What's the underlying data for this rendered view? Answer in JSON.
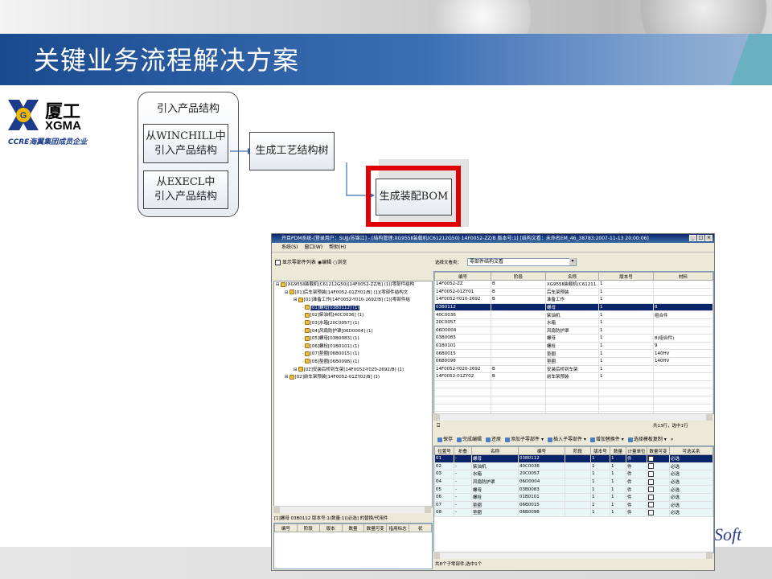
{
  "slide": {
    "title": "关键业务流程解决方案",
    "brand_logo_text": "Soft"
  },
  "company_logo": {
    "cn": "厦工",
    "en": "XGMA",
    "sub": "CCRE海翼集团成员企业"
  },
  "flow": {
    "group_title": "引入产品结构",
    "box_winchill": [
      "从WINCHILL中",
      "引入产品结构"
    ],
    "box_execl": [
      "从EXECL中",
      "引入产品结构"
    ],
    "box_tree": "生成工艺结构树",
    "box_bom": "生成装配BOM"
  },
  "window": {
    "title": "开目PDM系统-[登录用户：SUJJ/苏锦江] - [结构管理:XG955Ⅱ装载机(C61212G50) 14F0052-ZZ/B 版本号:1] [结构文看：未命名EM_46_38783:2007-11-13 20:00:06]",
    "menu": [
      "系统(S)",
      "窗口(W)",
      "帮助(H)"
    ],
    "left": {
      "show_list_label": "显示零部件列表",
      "mode_edit": "编辑",
      "mode_browse": "浏览",
      "tree": [
        {
          "indent": 0,
          "text": "[XG955Ⅱ装载机(C61212G50)[14F0052-ZZ/B] (1)[零部件结构",
          "sel": false
        },
        {
          "indent": 1,
          "text": "[01]后车架预装[14F0052-01ZY01/B] (1)[零部件结构文",
          "sel": false
        },
        {
          "indent": 2,
          "text": "[01]准备工作[14F0052-Y010-2692/B] (1)[零部件结",
          "sel": false
        },
        {
          "indent": 3,
          "text": "[01]螺母[03B0112] (1)",
          "sel": true
        },
        {
          "indent": 3,
          "text": "[02]柴油机[40C0036] (1)",
          "sel": false
        },
        {
          "indent": 3,
          "text": "[03]水箱[20C0057] (1)",
          "sel": false
        },
        {
          "indent": 3,
          "text": "[04]风扇防护罩[06D0004] (1)",
          "sel": false
        },
        {
          "indent": 3,
          "text": "[05]螺母[03B0083] (1)",
          "sel": false
        },
        {
          "indent": 3,
          "text": "[06]螺栓[01B0101] (1)",
          "sel": false
        },
        {
          "indent": 3,
          "text": "[07]垫圈[06B0015] (1)",
          "sel": false
        },
        {
          "indent": 3,
          "text": "[08]垫圈[06B0098] (1)",
          "sel": false
        },
        {
          "indent": 2,
          "text": "[02]安装后桥到车架[14F0052-Y020-2692/B] (1)",
          "sel": false
        },
        {
          "indent": 1,
          "text": "[02]前车架预装[14F0052-01ZY02/B] (1)",
          "sel": false
        }
      ],
      "sub_title": "[1]螺母 03B0112 版本号:1(数量:1)[必选] 的替换/代用件",
      "sub_headers": [
        "编号",
        "阶段",
        "版本",
        "数量",
        "数量可变",
        "指用标志",
        "状"
      ]
    },
    "right": {
      "doc_type_label": "选择文看类：",
      "doc_type_value": "零部件结构文看",
      "headers": [
        "编号",
        "阶段",
        "名称",
        "版本号",
        "材料"
      ],
      "rows": [
        {
          "code": "14F0052-ZZ",
          "stage": "B",
          "name": "XG955Ⅱ装载机(C61211",
          "ver": "1",
          "mat": "",
          "sel": false
        },
        {
          "code": "14F0052-01ZY01",
          "stage": "B",
          "name": "后车架预装",
          "ver": "1",
          "mat": "",
          "sel": false
        },
        {
          "code": "14F0052-Y010-2692",
          "stage": "B",
          "name": "准备工作",
          "ver": "1",
          "mat": "",
          "sel": false
        },
        {
          "code": "03B0112",
          "stage": "",
          "name": "螺母",
          "ver": "1",
          "mat": "8",
          "sel": true
        },
        {
          "code": "40C0036",
          "stage": "",
          "name": "柴油机",
          "ver": "1",
          "mat": "组合件",
          "sel": false
        },
        {
          "code": "20C0057",
          "stage": "",
          "name": "水箱",
          "ver": "1",
          "mat": "",
          "sel": false
        },
        {
          "code": "06D0004",
          "stage": "",
          "name": "风扇防护罩",
          "ver": "1",
          "mat": "",
          "sel": false
        },
        {
          "code": "03B0083",
          "stage": "",
          "name": "螺母",
          "ver": "1",
          "mat": "8(组合件)",
          "sel": false
        },
        {
          "code": "01B0101",
          "stage": "",
          "name": "螺栓",
          "ver": "1",
          "mat": "9",
          "sel": false
        },
        {
          "code": "06B0015",
          "stage": "",
          "name": "垫圈",
          "ver": "1",
          "mat": "140HV",
          "sel": false
        },
        {
          "code": "06B0098",
          "stage": "",
          "name": "垫圈",
          "ver": "1",
          "mat": "140HV",
          "sel": false
        },
        {
          "code": "14F0052-Y020-2692",
          "stage": "B",
          "name": "安装后桥到车架",
          "ver": "1",
          "mat": "",
          "sel": false
        },
        {
          "code": "14F0052-01ZY02",
          "stage": "B",
          "name": "前车架预装",
          "ver": "1",
          "mat": "",
          "sel": false
        }
      ],
      "count_text": "共13行，选中1行",
      "toolbar": [
        "保存",
        "完成编辑",
        "还原",
        "添加子零部件 ▾",
        "插入子零部件 ▾",
        "增加替换件 ▾",
        "选择模板复制 ▾",
        "»"
      ],
      "headers2": [
        "位置号",
        "折叠",
        "名称",
        "编号",
        "阶段",
        "版本号",
        "数量",
        "计量单位",
        "数量可变",
        "可选关系"
      ],
      "rows2": [
        {
          "pos": "01",
          "fold": "-",
          "name": "螺母",
          "code": "03B0112",
          "stage": "",
          "ver": "1",
          "qty": "1",
          "unit": "件",
          "opt": "必选",
          "sel": true
        },
        {
          "pos": "02",
          "fold": "-",
          "name": "柴油机",
          "code": "40C0036",
          "stage": "",
          "ver": "1",
          "qty": "1",
          "unit": "件",
          "opt": "必选",
          "sel": false
        },
        {
          "pos": "03",
          "fold": "-",
          "name": "水箱",
          "code": "20C0057",
          "stage": "",
          "ver": "1",
          "qty": "1",
          "unit": "件",
          "opt": "必选",
          "sel": false
        },
        {
          "pos": "04",
          "fold": "-",
          "name": "风扇防护罩",
          "code": "06D0004",
          "stage": "",
          "ver": "1",
          "qty": "1",
          "unit": "件",
          "opt": "必选",
          "sel": false
        },
        {
          "pos": "05",
          "fold": "-",
          "name": "螺母",
          "code": "03B0083",
          "stage": "",
          "ver": "1",
          "qty": "1",
          "unit": "件",
          "opt": "必选",
          "sel": false
        },
        {
          "pos": "06",
          "fold": "-",
          "name": "螺栓",
          "code": "01B0101",
          "stage": "",
          "ver": "1",
          "qty": "1",
          "unit": "件",
          "opt": "必选",
          "sel": false
        },
        {
          "pos": "07",
          "fold": "-",
          "name": "垫圈",
          "code": "06B0015",
          "stage": "",
          "ver": "1",
          "qty": "1",
          "unit": "件",
          "opt": "必选",
          "sel": false
        },
        {
          "pos": "08",
          "fold": "-",
          "name": "垫圈",
          "code": "06B0098",
          "stage": "",
          "ver": "1",
          "qty": "1",
          "unit": "件",
          "opt": "必选",
          "sel": false
        }
      ],
      "status2": "共8个子零部件,选中1个"
    }
  }
}
